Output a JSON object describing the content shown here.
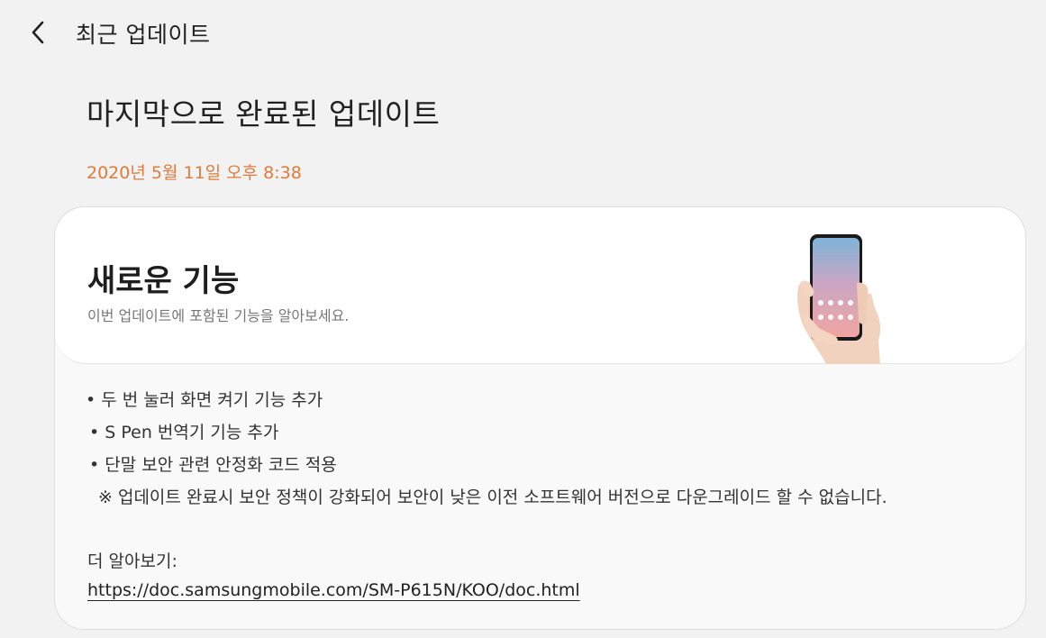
{
  "header": {
    "back_icon": "chevron-left-icon",
    "title": "최근 업데이트"
  },
  "main": {
    "heading": "마지막으로 완료된 업데이트",
    "date": "2020년 5월 11일 오후 8:38",
    "date_color": "#e07b39"
  },
  "card": {
    "title": "새로운 기능",
    "subtitle": "이번 업데이트에 포함된 기능을 알아보세요.",
    "illustration_icon": "hand-holding-phone-icon",
    "notes": [
      "• 두 번 눌러 화면 켜기 기능 추가",
      "• S Pen 번역기 기능 추가",
      "• 단말 보안 관련 안정화 코드 적용",
      "※ 업데이트 완료시 보안 정책이 강화되어 보안이 낮은 이전 소프트웨어 버전으로 다운그레이드 할 수 없습니다."
    ],
    "more_label": "더 알아보기:",
    "more_link": "https://doc.samsungmobile.com/SM-P615N/KOO/doc.html"
  }
}
